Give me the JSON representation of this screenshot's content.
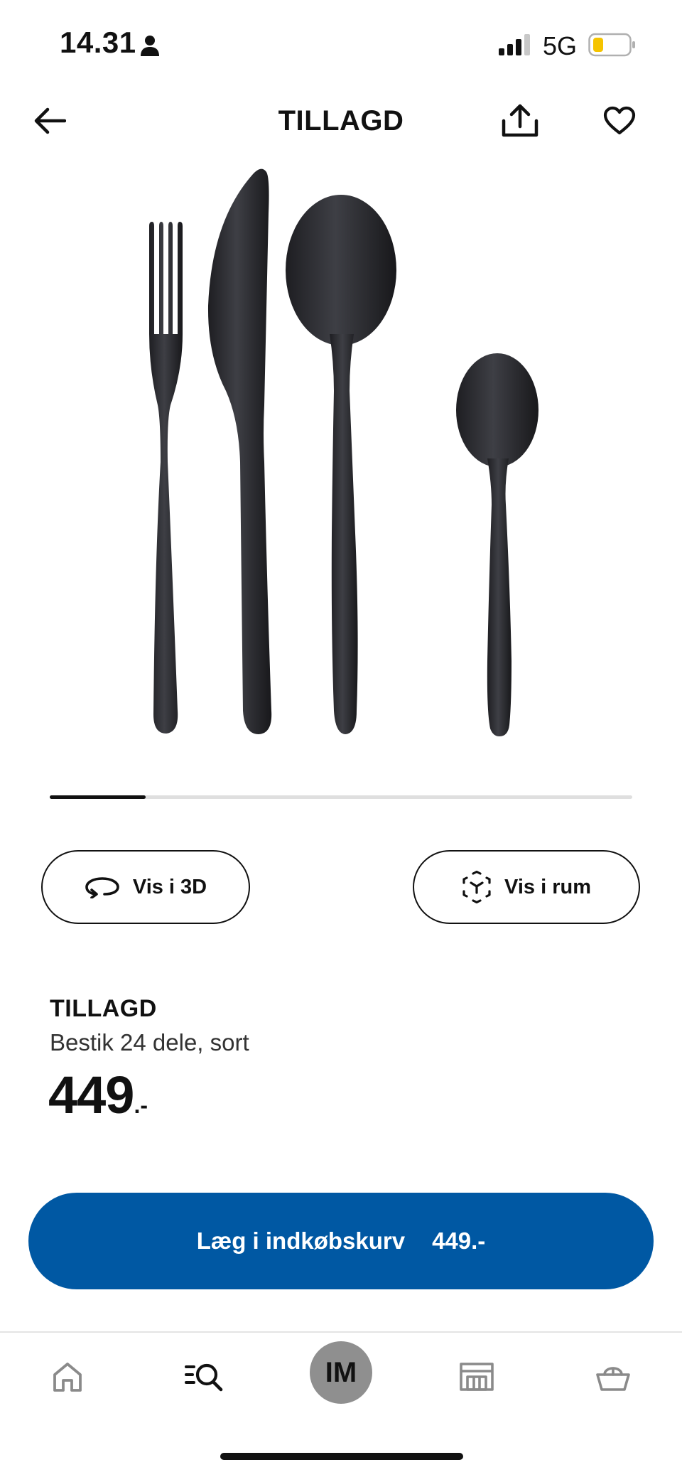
{
  "status_bar": {
    "time": "14.31",
    "network": "5G",
    "battery_color": "#f5c400"
  },
  "header": {
    "title": "TILLAGD",
    "back_icon": "arrow-left-icon",
    "share_icon": "share-icon",
    "favorite_icon": "heart-icon"
  },
  "gallery": {
    "image_subject": "cutlery-set-black",
    "progress": 0.165
  },
  "actions": {
    "view_3d_label": "Vis i 3D",
    "view_3d_icon": "rotate-3d-icon",
    "view_in_room_label": "Vis i rum",
    "view_in_room_icon": "ar-cube-icon"
  },
  "product": {
    "name": "TILLAGD",
    "description": "Bestik 24 dele, sort",
    "price": "449",
    "price_suffix": ".-"
  },
  "cart_button": {
    "label": "Læg i indkøbskurv",
    "price": "449.-",
    "color": "#0058a3"
  },
  "bottom_nav": {
    "profile_initials": "IM",
    "items": [
      "home-icon",
      "search-icon",
      "profile-avatar",
      "store-icon",
      "basket-icon"
    ]
  }
}
